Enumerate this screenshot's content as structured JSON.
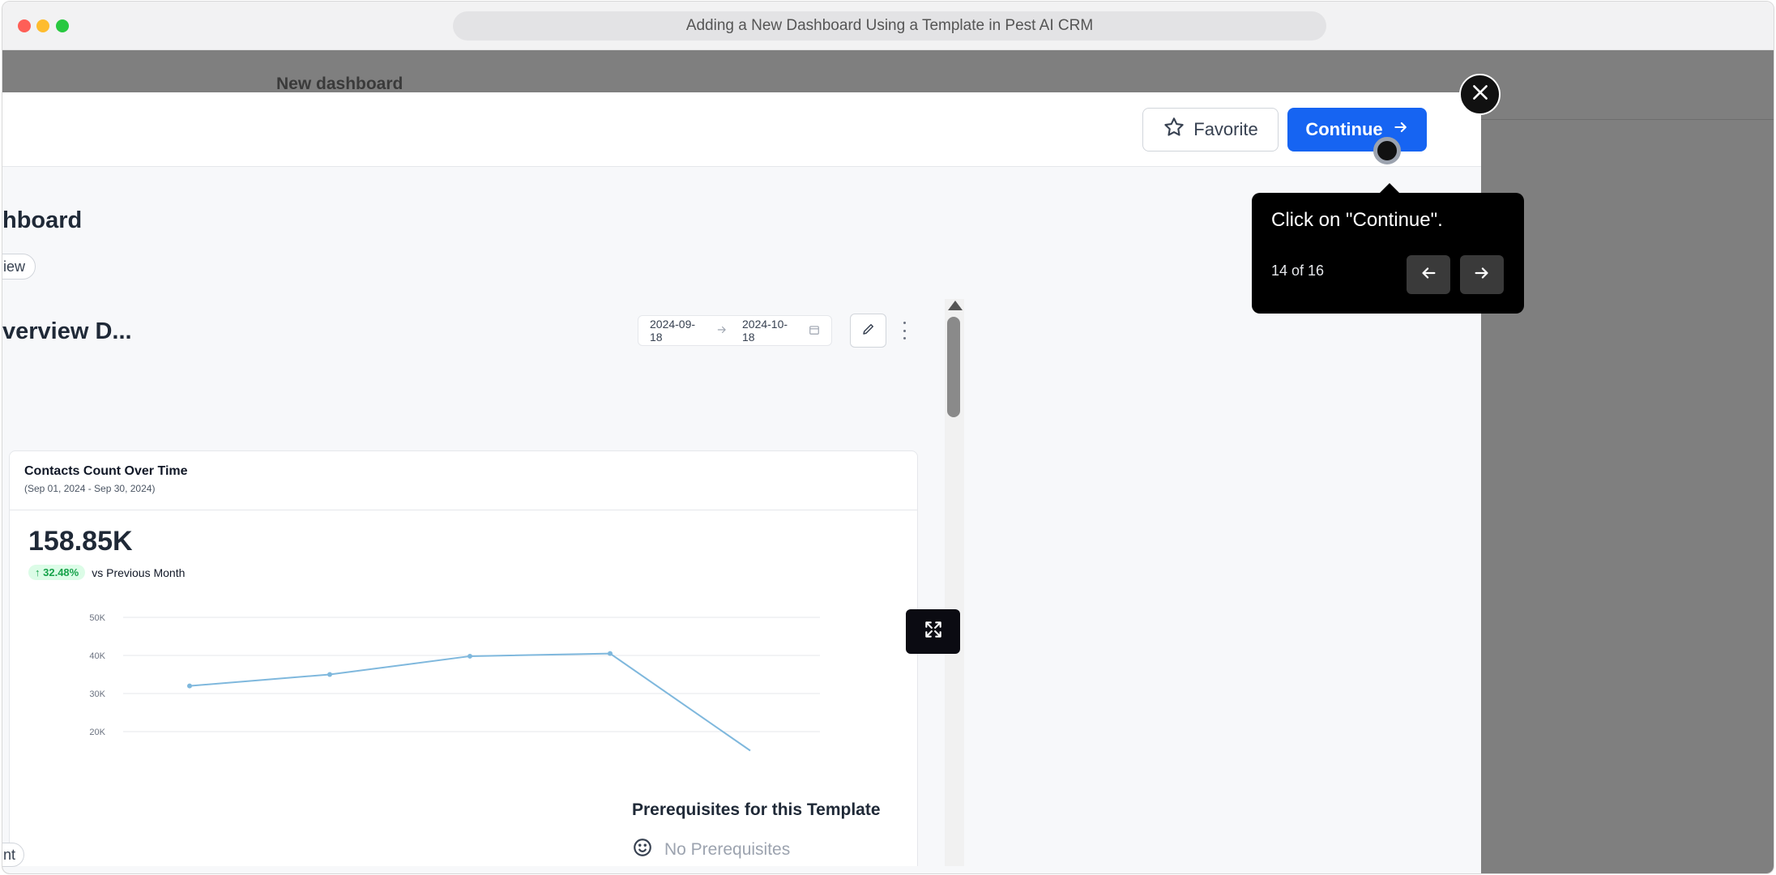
{
  "window": {
    "title": "Adding a New Dashboard Using a Template in Pest AI CRM"
  },
  "background": {
    "title": "New dashboard"
  },
  "modal": {
    "favorite_label": "Favorite",
    "continue_label": "Continue",
    "dashboard_title": "hboard",
    "tag_label": "iew",
    "preview": {
      "title": "verview D...",
      "date_from": "2024-09-18",
      "date_to": "2024-10-18",
      "card": {
        "title": "Contacts Count Over Time",
        "subtitle": "(Sep 01, 2024 - Sep 30, 2024)",
        "value": "158.85K",
        "delta": "32.48%",
        "delta_label": "vs Previous Month"
      }
    },
    "prereq_title": "Prerequisites for this Template",
    "prereq_value": "No Prerequisites",
    "bottom_tag": "nt"
  },
  "tooltip": {
    "text": "Click on \"Continue\".",
    "step": "14 of 16"
  },
  "chart_data": {
    "type": "line",
    "y_ticks": [
      "50K",
      "40K",
      "30K",
      "20K"
    ],
    "ylim": [
      20000,
      50000
    ],
    "series": [
      {
        "values": [
          32000,
          35000,
          39800,
          40500,
          15000
        ]
      }
    ],
    "line_color": "#7fb8dd"
  }
}
